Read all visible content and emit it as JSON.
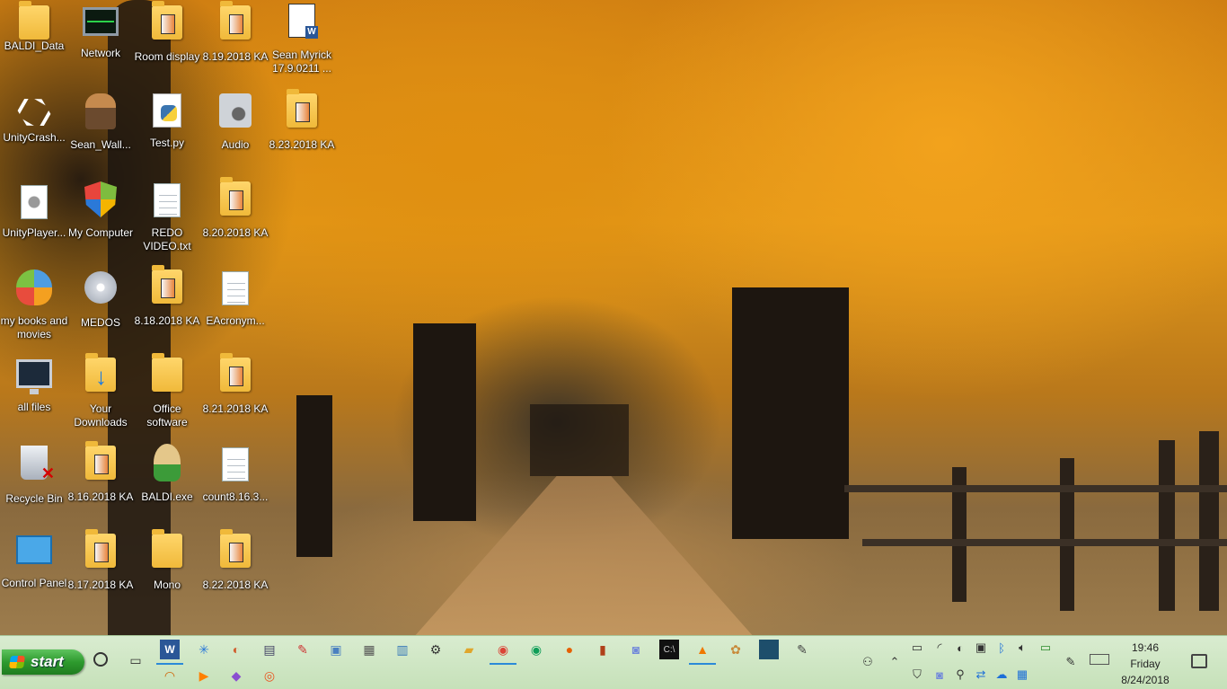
{
  "desktop": {
    "icons": [
      {
        "label": "BALDI_Data",
        "type": "folder"
      },
      {
        "label": "Network",
        "type": "network"
      },
      {
        "label": "Room display",
        "type": "folder"
      },
      {
        "label": "8.19.2018 KA",
        "type": "ka"
      },
      {
        "label": "Sean Myrick 17.9.0211 ...",
        "type": "word"
      },
      {
        "label": "UnityCrash...",
        "type": "unity"
      },
      {
        "label": "Sean_Wall...",
        "type": "user"
      },
      {
        "label": "Test.py",
        "type": "python"
      },
      {
        "label": "Audio",
        "type": "audio"
      },
      {
        "label": "8.23.2018 KA",
        "type": "ka"
      },
      {
        "label": "UnityPlayer...",
        "type": "settings-file"
      },
      {
        "label": "My Computer",
        "type": "shield"
      },
      {
        "label": "REDO VIDEO.txt",
        "type": "text"
      },
      {
        "label": "8.20.2018 KA",
        "type": "ka"
      },
      {
        "label": "my books and movies",
        "type": "butterfly"
      },
      {
        "label": "MEDOS",
        "type": "disc"
      },
      {
        "label": "8.18.2018 KA",
        "type": "ka"
      },
      {
        "label": "EAcronym...",
        "type": "text"
      },
      {
        "label": "all files",
        "type": "monitor"
      },
      {
        "label": "Your Downloads",
        "type": "download"
      },
      {
        "label": "Office software",
        "type": "folder"
      },
      {
        "label": "8.21.2018 KA",
        "type": "ka"
      },
      {
        "label": "Recycle Bin",
        "type": "bin"
      },
      {
        "label": "8.16.2018 KA",
        "type": "ka"
      },
      {
        "label": "BALDI.exe",
        "type": "baldi"
      },
      {
        "label": "count8.16.3...",
        "type": "text"
      },
      {
        "label": "Control Panel",
        "type": "control-panel"
      },
      {
        "label": "8.17.2018 KA",
        "type": "ka"
      },
      {
        "label": "Mono",
        "type": "folder"
      },
      {
        "label": "8.22.2018 KA",
        "type": "ka"
      }
    ]
  },
  "taskbar": {
    "start_label": "start",
    "clock": {
      "time": "19:46",
      "day": "Friday",
      "date": "8/24/2018"
    },
    "colors": {
      "taskbar_bg": "#c6e1b9",
      "start_green": "#2e9a2e",
      "accent_underline": "#2b8ad8"
    }
  }
}
